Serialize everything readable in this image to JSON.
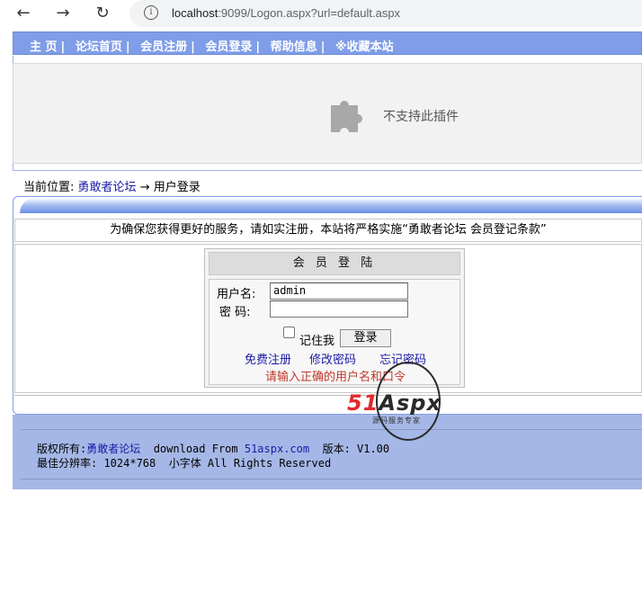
{
  "browser": {
    "url_host": "localhost",
    "url_rest": ":9099/Logon.aspx?url=default.aspx"
  },
  "topnav": {
    "items": [
      "主 页",
      "论坛首页",
      "会员注册",
      "会员登录",
      "帮助信息",
      "※收藏本站"
    ],
    "separator": "|"
  },
  "plugin": {
    "message": "不支持此插件"
  },
  "breadcrumb": {
    "prefix": "当前位置:",
    "forum_link": "勇敢者论坛",
    "arrow": "→",
    "current": "用户登录"
  },
  "notice": "为确保您获得更好的服务，请如实注册，本站将严格实施“勇敢者论坛 会员登记条款”",
  "login": {
    "title": "会 员 登 陆",
    "username_label": "用户名:",
    "username_value": "admin",
    "password_label": "密 码:",
    "password_value": "",
    "remember_label": "记住我",
    "submit_label": "登录",
    "register_link": "免费注册",
    "change_password_link": "修改密码",
    "forgot_password_link": "忘记密码",
    "error_message": "请输入正确的用户名和口令"
  },
  "footer": {
    "copyright_prefix": "版权所有:",
    "copyright_link": "勇敢者论坛",
    "download_text": "download From",
    "download_link": "51aspx.com",
    "version_text": "版本: V1.00",
    "resolution_text": "最佳分辨率: 1024*768",
    "font_text": "小字体 All Rights Reserved"
  },
  "watermark": {
    "brand_51": "51",
    "brand_aspx": "Aspx",
    "slogan": "源码服务专家"
  },
  "colors": {
    "nav_bg": "#7f9de8",
    "footer_bg": "#a5b7e6",
    "link": "#1a1aa6",
    "error": "#c0392b"
  }
}
